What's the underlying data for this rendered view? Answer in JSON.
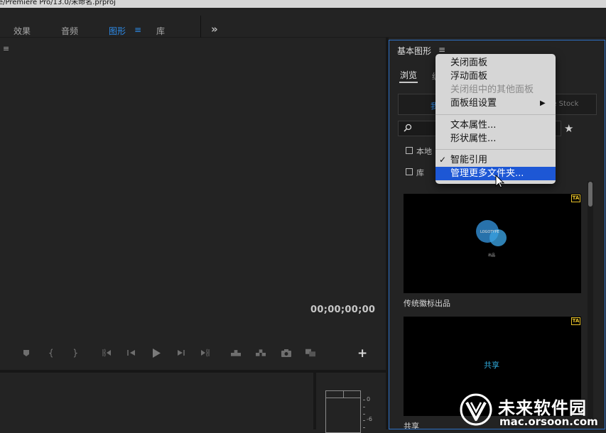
{
  "titlebar": {
    "path": "e/Premiere Pro/13.0/未命名.prproj"
  },
  "workspaces": {
    "items": [
      {
        "label": "效果"
      },
      {
        "label": "音频"
      },
      {
        "label": "图形"
      },
      {
        "label": "库"
      }
    ],
    "active": "图形",
    "menu_glyph": "≡",
    "more_glyph": "»"
  },
  "program_monitor": {
    "menu_glyph": "≡",
    "timecode": "00;00;00;00",
    "controls": [
      "add-marker-icon",
      "mark-in-icon",
      "mark-out-icon",
      "go-to-in-icon",
      "step-back-icon",
      "play-icon",
      "step-forward-icon",
      "go-to-out-icon",
      "lift-icon",
      "extract-icon",
      "export-frame-icon",
      "comparison-view-icon"
    ],
    "add_glyph": "+"
  },
  "audio_meter": {
    "labels": [
      "0",
      "-6"
    ]
  },
  "essential_graphics": {
    "title": "基本图形",
    "menu_glyph": "≡",
    "tabs": [
      {
        "label": "浏览"
      },
      {
        "label": "编辑"
      }
    ],
    "source": {
      "left_label": "我",
      "right_label": "be Stock"
    },
    "search": {
      "icon": "search-icon"
    },
    "filters": [
      {
        "label": "本地"
      },
      {
        "label": "库"
      }
    ],
    "templates": [
      {
        "caption": "传统徽标出品",
        "logo_text": "LOGOTYPE",
        "sub_text": "出品",
        "badge": "TA"
      },
      {
        "caption": "共享",
        "center_text": "共享",
        "badge": "TA"
      }
    ]
  },
  "dropdown_menu": {
    "items": [
      {
        "label": "关闭面板"
      },
      {
        "label": "浮动面板"
      },
      {
        "label": "关闭组中的其他面板"
      },
      {
        "label": "面板组设置"
      },
      {
        "label": "文本属性..."
      },
      {
        "label": "形状属性..."
      },
      {
        "label": "智能引用"
      },
      {
        "label": "管理更多文件夹..."
      }
    ],
    "arrow_glyph": "▶",
    "check_glyph": "✓"
  },
  "watermark": {
    "title": "未来软件园",
    "url": "mac.orsoon.com"
  },
  "colors": {
    "accent": "#2d8ceb",
    "highlight": "#1d57d5",
    "panel_border": "#2e72c8",
    "badge": "#e6c02a"
  }
}
